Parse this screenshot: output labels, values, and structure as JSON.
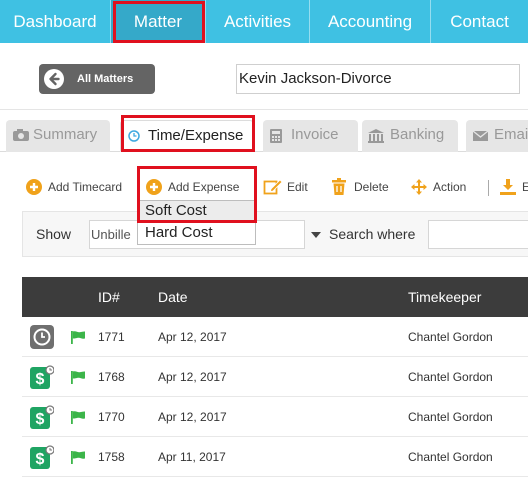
{
  "nav": {
    "items": [
      {
        "label": "Dashboard",
        "active": false
      },
      {
        "label": "Matter",
        "active": true
      },
      {
        "label": "Activities",
        "active": false
      },
      {
        "label": "Accounting",
        "active": false
      },
      {
        "label": "Contact",
        "active": false
      }
    ]
  },
  "matter": {
    "all_matters_label": "All Matters",
    "current_matter": "Kevin Jackson-Divorce"
  },
  "tabs": [
    {
      "label": "Summary",
      "icon": "camera-icon",
      "active": false
    },
    {
      "label": "Time/Expense",
      "icon": "clock-icon",
      "active": true
    },
    {
      "label": "Invoice",
      "icon": "calculator-icon",
      "active": false
    },
    {
      "label": "Banking",
      "icon": "bank-icon",
      "active": false
    },
    {
      "label": "Emai",
      "icon": "envelope-icon",
      "active": false
    }
  ],
  "toolbar": {
    "add_timecard": "Add Timecard",
    "add_expense": "Add Expense",
    "edit": "Edit",
    "delete": "Delete",
    "action": "Action",
    "export_fragment": "E"
  },
  "expense_menu": {
    "options": [
      "Soft Cost",
      "Hard Cost"
    ],
    "highlighted": "Soft Cost"
  },
  "filter": {
    "show_label": "Show",
    "show_value": "Unbille",
    "search_label": "Search where"
  },
  "table": {
    "columns": [
      "ID#",
      "Date",
      "Timekeeper"
    ],
    "rows": [
      {
        "type": "time",
        "id": "1771",
        "date": "Apr 12, 2017",
        "timekeeper": "Chantel Gordon"
      },
      {
        "type": "expense",
        "id": "1768",
        "date": "Apr 12, 2017",
        "timekeeper": "Chantel Gordon"
      },
      {
        "type": "expense",
        "id": "1770",
        "date": "Apr 12, 2017",
        "timekeeper": "Chantel Gordon"
      },
      {
        "type": "expense",
        "id": "1758",
        "date": "Apr 11, 2017",
        "timekeeper": "Chantel Gordon"
      }
    ]
  },
  "colors": {
    "nav_bg": "#3fc1e3",
    "highlight_red": "#e0101e",
    "accent_orange": "#f0a21b",
    "flag_green": "#3cb54a",
    "expense_green": "#1fa463",
    "header_dark": "#3c3c3c"
  }
}
